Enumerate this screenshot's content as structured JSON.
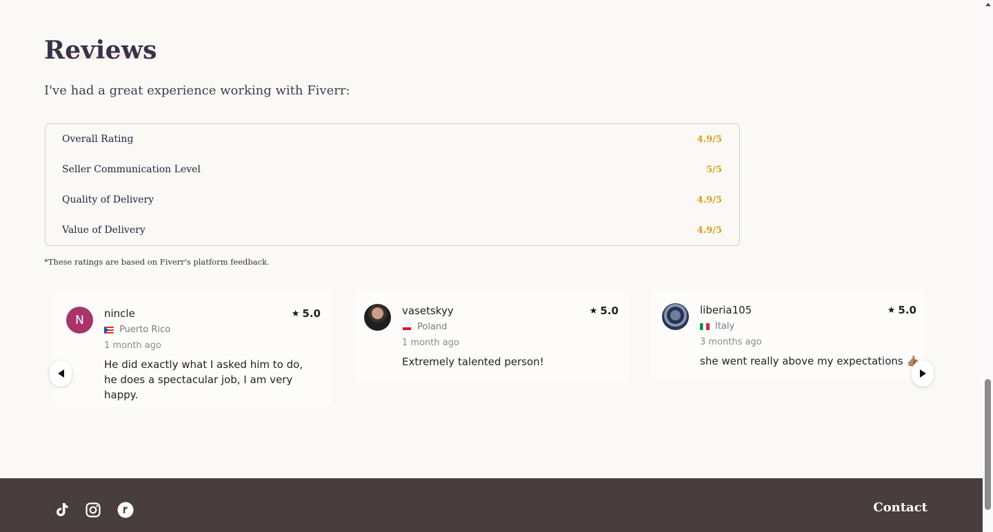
{
  "reviews": {
    "title": "Reviews",
    "intro": "I've had a great experience working with Fiverr:"
  },
  "ratings": [
    {
      "label": "Overall Rating",
      "value": "4.9/5"
    },
    {
      "label": "Seller Communication Level",
      "value": "5/5"
    },
    {
      "label": "Quality of Delivery",
      "value": "4.9/5"
    },
    {
      "label": "Value of Delivery",
      "value": "4.9/5"
    }
  ],
  "rating_note": "*These ratings are based on Fiverr's platform feedback.",
  "review_cards": [
    {
      "avatar_letter": "N",
      "name": "nincle",
      "country": "Puerto Rico",
      "time": "1 month ago",
      "rating": "5.0",
      "text": "He did exactly what I asked him to do, he does a spectacular job, I am very happy."
    },
    {
      "name": "vasetskyy",
      "country": "Poland",
      "time": "1 month ago",
      "rating": "5.0",
      "text": "Extremely talented person!"
    },
    {
      "name": "liberia105",
      "country": "Italy",
      "time": "3 months ago",
      "rating": "5.0",
      "text": "she went really above my expectations 👍🏽"
    }
  ],
  "footer": {
    "social_icons": [
      "tiktok-icon",
      "instagram-icon",
      "r-icon"
    ],
    "contact_label": "Contact"
  },
  "colors": {
    "background": "#fbf9f6",
    "rating_value": "#d4a017",
    "footer_bg": "#483e3e",
    "avatar_bg": "#a8346a"
  }
}
